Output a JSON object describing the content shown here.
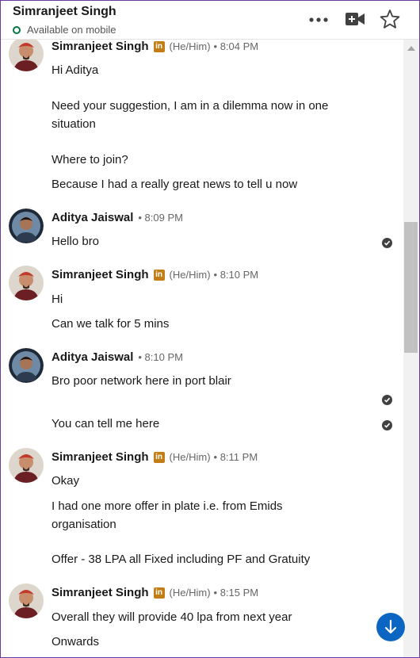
{
  "header": {
    "contact_name": "Simranjeet Singh",
    "status": "Available on mobile",
    "icons": [
      "more-options-icon",
      "video-call-icon",
      "star-icon"
    ]
  },
  "pronouns": "(He/Him)",
  "linkedin_badge": "in",
  "messages": [
    {
      "sender": "Simranjeet Singh",
      "time": "• 8:04 PM",
      "lines": [
        "Hi Aditya",
        "Need your suggestion, I am in a dilemma now in one",
        "situation",
        "Where to join?",
        "Because I had a really great news to tell u now"
      ]
    },
    {
      "sender": "Aditya Jaiswal",
      "time": "• 8:09 PM",
      "lines": [
        "Hello bro"
      ]
    },
    {
      "sender": "Simranjeet Singh",
      "time": "• 8:10 PM",
      "lines": [
        "Hi",
        "Can we talk for 5 mins"
      ]
    },
    {
      "sender": "Aditya Jaiswal",
      "time": "• 8:10 PM",
      "lines": [
        "Bro poor network here in port blair",
        "You can tell me here"
      ]
    },
    {
      "sender": "Simranjeet Singh",
      "time": "• 8:11 PM",
      "lines": [
        "Okay",
        "I had one more offer in plate i.e. from Emids",
        "organisation",
        "Offer - 38 LPA all Fixed including PF and Gratuity"
      ]
    },
    {
      "sender": "Simranjeet Singh",
      "time": "• 8:15 PM",
      "lines": [
        "Overall they will provide 40 lpa from next year",
        "Onwards"
      ]
    }
  ],
  "colors": {
    "accent": "#0a66c2",
    "online": "#057642",
    "linkedin": "#c37d16"
  }
}
